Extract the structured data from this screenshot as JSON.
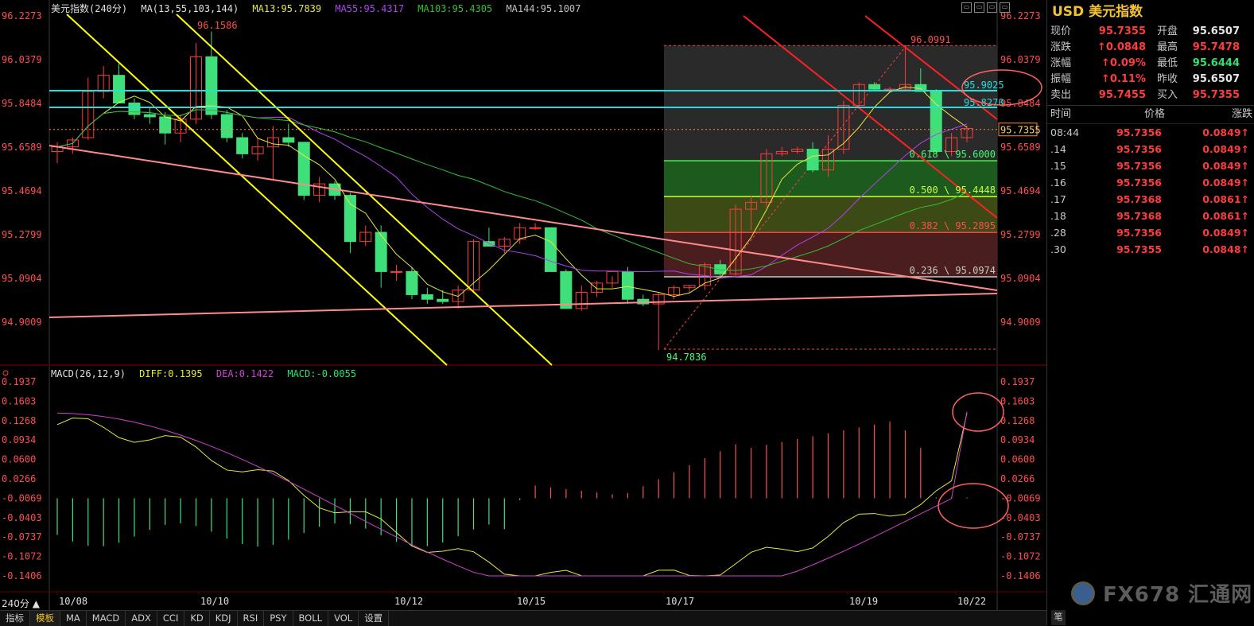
{
  "header": {
    "symbol": "美元指数(240分)",
    "ma_label": "MA(13,55,103,144)",
    "ma13": "MA13:95.7839",
    "ma55": "MA55:95.4317",
    "ma103": "MA103:95.4305",
    "ma144": "MA144:95.1007"
  },
  "macd_header": {
    "label": "MACD(26,12,9)",
    "diff": "DIFF:0.1395",
    "dea": "DEA:0.1422",
    "macd": "MACD:-0.0055"
  },
  "colors": {
    "up": "#ff3b3b",
    "down": "#3fe07a",
    "ma13": "#e8e838",
    "ma55": "#b040f0",
    "ma103": "#30c030",
    "ma144": "#c0c0c0",
    "cyan": "#20e0e0",
    "trend_yellow": "#ffff00",
    "trend_red": "#ff2020",
    "trend_pink": "#ff8a8a"
  },
  "price_axis": [
    "96.2273",
    "96.0379",
    "95.8484",
    "95.6589",
    "95.4694",
    "95.2799",
    "95.0904",
    "94.9009"
  ],
  "macd_axis": [
    "0.1937",
    "0.1603",
    "0.1268",
    "0.0934",
    "0.0600",
    "0.0266",
    "-0.0069",
    "-0.0403",
    "-0.0737",
    "-0.1072",
    "-0.1406"
  ],
  "date_labels": [
    "10/08",
    "10/10",
    "10/12",
    "10/15",
    "10/17",
    "10/19",
    "10/22"
  ],
  "annotations": {
    "high_left": "96.1586",
    "high_right": "96.0991",
    "low": "94.7836",
    "cyan1": "95.9025",
    "cyan2": "95.8270",
    "current_tag": "95.7355",
    "fib618": "0.618 \\ 95.6000",
    "fib500": "0.500 \\ 95.4448",
    "fib382": "0.382 \\ 95.2895",
    "fib236": "0.236 \\ 95.0974"
  },
  "chart_data": {
    "type": "candlestick",
    "title": "美元指数(240分)",
    "candles": [
      {
        "o": 95.64,
        "h": 95.68,
        "l": 95.59,
        "c": 95.66
      },
      {
        "o": 95.66,
        "h": 95.7,
        "l": 95.63,
        "c": 95.69
      },
      {
        "o": 95.7,
        "h": 95.96,
        "l": 95.69,
        "c": 95.9
      },
      {
        "o": 95.9,
        "h": 96.01,
        "l": 95.87,
        "c": 95.97
      },
      {
        "o": 95.97,
        "h": 96.02,
        "l": 95.85,
        "c": 95.85
      },
      {
        "o": 95.85,
        "h": 95.87,
        "l": 95.78,
        "c": 95.8
      },
      {
        "o": 95.8,
        "h": 95.83,
        "l": 95.76,
        "c": 95.79
      },
      {
        "o": 95.79,
        "h": 95.81,
        "l": 95.67,
        "c": 95.72
      },
      {
        "o": 95.72,
        "h": 95.8,
        "l": 95.68,
        "c": 95.78
      },
      {
        "o": 95.78,
        "h": 96.11,
        "l": 95.76,
        "c": 96.05
      },
      {
        "o": 96.05,
        "h": 96.16,
        "l": 95.78,
        "c": 95.8
      },
      {
        "o": 95.8,
        "h": 95.82,
        "l": 95.68,
        "c": 95.7
      },
      {
        "o": 95.7,
        "h": 95.72,
        "l": 95.61,
        "c": 95.63
      },
      {
        "o": 95.63,
        "h": 95.7,
        "l": 95.6,
        "c": 95.66
      },
      {
        "o": 95.66,
        "h": 95.75,
        "l": 95.52,
        "c": 95.7
      },
      {
        "o": 95.7,
        "h": 95.76,
        "l": 95.66,
        "c": 95.68
      },
      {
        "o": 95.68,
        "h": 95.68,
        "l": 95.43,
        "c": 95.45
      },
      {
        "o": 95.45,
        "h": 95.53,
        "l": 95.42,
        "c": 95.5
      },
      {
        "o": 95.5,
        "h": 95.51,
        "l": 95.43,
        "c": 95.45
      },
      {
        "o": 95.45,
        "h": 95.46,
        "l": 95.2,
        "c": 95.25
      },
      {
        "o": 95.25,
        "h": 95.32,
        "l": 95.23,
        "c": 95.29
      },
      {
        "o": 95.29,
        "h": 95.32,
        "l": 95.05,
        "c": 95.12
      },
      {
        "o": 95.12,
        "h": 95.15,
        "l": 95.08,
        "c": 95.12
      },
      {
        "o": 95.12,
        "h": 95.14,
        "l": 95.0,
        "c": 95.02
      },
      {
        "o": 95.02,
        "h": 95.05,
        "l": 94.98,
        "c": 95.0
      },
      {
        "o": 95.0,
        "h": 95.04,
        "l": 94.98,
        "c": 94.99
      },
      {
        "o": 94.99,
        "h": 95.06,
        "l": 94.96,
        "c": 95.04
      },
      {
        "o": 95.04,
        "h": 95.26,
        "l": 95.03,
        "c": 95.25
      },
      {
        "o": 95.25,
        "h": 95.31,
        "l": 95.23,
        "c": 95.23
      },
      {
        "o": 95.23,
        "h": 95.27,
        "l": 95.2,
        "c": 95.26
      },
      {
        "o": 95.26,
        "h": 95.33,
        "l": 95.24,
        "c": 95.31
      },
      {
        "o": 95.31,
        "h": 95.33,
        "l": 95.3,
        "c": 95.31
      },
      {
        "o": 95.31,
        "h": 95.31,
        "l": 95.12,
        "c": 95.12
      },
      {
        "o": 95.12,
        "h": 95.13,
        "l": 94.96,
        "c": 94.96
      },
      {
        "o": 94.96,
        "h": 95.06,
        "l": 94.95,
        "c": 95.03
      },
      {
        "o": 95.03,
        "h": 95.08,
        "l": 95.01,
        "c": 95.07
      },
      {
        "o": 95.07,
        "h": 95.1,
        "l": 95.05,
        "c": 95.12
      },
      {
        "o": 95.12,
        "h": 95.14,
        "l": 94.98,
        "c": 95.0
      },
      {
        "o": 95.0,
        "h": 95.02,
        "l": 94.97,
        "c": 94.98
      },
      {
        "o": 94.98,
        "h": 95.03,
        "l": 94.78,
        "c": 95.02
      },
      {
        "o": 95.02,
        "h": 95.06,
        "l": 95.0,
        "c": 95.05
      },
      {
        "o": 95.05,
        "h": 95.06,
        "l": 95.03,
        "c": 95.06
      },
      {
        "o": 95.06,
        "h": 95.16,
        "l": 95.04,
        "c": 95.15
      },
      {
        "o": 95.15,
        "h": 95.17,
        "l": 95.1,
        "c": 95.11
      },
      {
        "o": 95.11,
        "h": 95.41,
        "l": 95.1,
        "c": 95.39
      },
      {
        "o": 95.39,
        "h": 95.45,
        "l": 95.3,
        "c": 95.42
      },
      {
        "o": 95.42,
        "h": 95.65,
        "l": 95.4,
        "c": 95.63
      },
      {
        "o": 95.63,
        "h": 95.66,
        "l": 95.62,
        "c": 95.64
      },
      {
        "o": 95.64,
        "h": 95.66,
        "l": 95.63,
        "c": 95.65
      },
      {
        "o": 95.65,
        "h": 95.68,
        "l": 95.55,
        "c": 95.56
      },
      {
        "o": 95.56,
        "h": 95.71,
        "l": 95.53,
        "c": 95.65
      },
      {
        "o": 95.65,
        "h": 95.86,
        "l": 95.63,
        "c": 95.84
      },
      {
        "o": 95.84,
        "h": 95.94,
        "l": 95.83,
        "c": 95.93
      },
      {
        "o": 95.93,
        "h": 95.94,
        "l": 95.9,
        "c": 95.91
      },
      {
        "o": 95.91,
        "h": 95.92,
        "l": 95.9,
        "c": 95.91
      },
      {
        "o": 95.91,
        "h": 96.1,
        "l": 95.9,
        "c": 95.93
      },
      {
        "o": 95.93,
        "h": 96.0,
        "l": 95.9,
        "c": 95.9
      },
      {
        "o": 95.9,
        "h": 95.91,
        "l": 95.63,
        "c": 95.64
      },
      {
        "o": 95.64,
        "h": 95.72,
        "l": 95.62,
        "c": 95.7
      },
      {
        "o": 95.7,
        "h": 95.75,
        "l": 95.68,
        "c": 95.74
      }
    ],
    "macd": {
      "diff": 0.1395,
      "dea": 0.1422,
      "macd": -0.0055
    }
  },
  "panel": {
    "title": "USD 美元指数",
    "quotes": [
      {
        "l": "现价",
        "v": "95.7355",
        "vc": "red",
        "l2": "开盘",
        "v2": "95.6507",
        "v2c": "white"
      },
      {
        "l": "涨跌",
        "v": "↑0.0848",
        "vc": "red",
        "l2": "最高",
        "v2": "95.7478",
        "v2c": "red"
      },
      {
        "l": "涨幅",
        "v": "↑0.09%",
        "vc": "red",
        "l2": "最低",
        "v2": "95.6444",
        "v2c": "green"
      },
      {
        "l": "振幅",
        "v": "↑0.11%",
        "vc": "red",
        "l2": "昨收",
        "v2": "95.6507",
        "v2c": "white"
      },
      {
        "l": "卖出",
        "v": "95.7455",
        "vc": "red",
        "l2": "买入",
        "v2": "95.7355",
        "v2c": "red"
      }
    ],
    "table_headers": {
      "time": "时间",
      "price": "价格",
      "change": "涨跌"
    },
    "ticks": [
      {
        "t": "08:44",
        "p": "95.7356",
        "c": "0.0849↑"
      },
      {
        "t": ".14",
        "p": "95.7356",
        "c": "0.0849↑"
      },
      {
        "t": ".15",
        "p": "95.7356",
        "c": "0.0849↑"
      },
      {
        "t": ".16",
        "p": "95.7356",
        "c": "0.0849↑"
      },
      {
        "t": ".17",
        "p": "95.7368",
        "c": "0.0861↑"
      },
      {
        "t": ".18",
        "p": "95.7368",
        "c": "0.0861↑"
      },
      {
        "t": ".28",
        "p": "95.7356",
        "c": "0.0849↑"
      },
      {
        "t": ".30",
        "p": "95.7355",
        "c": "0.0848↑"
      }
    ],
    "logo": "FX678 汇通网",
    "side_tab": "笔"
  },
  "tabs": [
    "指标",
    "模板",
    "MA",
    "MACD",
    "ADX",
    "CCI",
    "KD",
    "KDJ",
    "RSI",
    "PSY",
    "BOLL",
    "VOL",
    "设置"
  ],
  "active_tab": "模板",
  "period": "240分 ▲"
}
